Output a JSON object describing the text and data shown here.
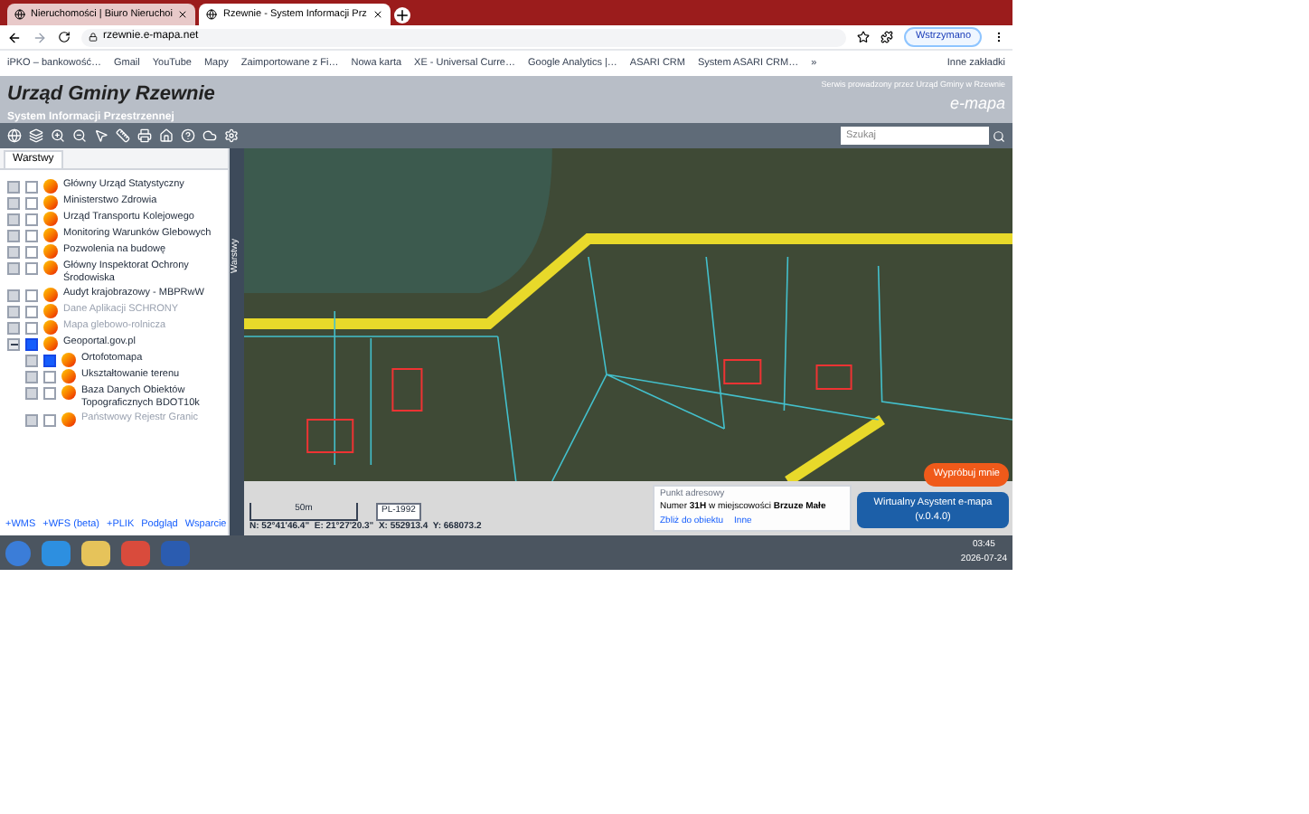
{
  "browser": {
    "tabs": [
      {
        "label": "Nieruchomości | Biuro Nieruchoi",
        "selected": false
      },
      {
        "label": "Rzewnie - System Informacji Prz",
        "selected": true
      }
    ],
    "address": "rzewnie.e-mapa.net",
    "profile": "Wstrzymano",
    "bookmarks": [
      "iPKO – bankowość…",
      "Gmail",
      "YouTube",
      "Mapy",
      "Zaimportowane z Fi…",
      "Nowa karta",
      "XE - Universal Curre…",
      "Google Analytics |…",
      "ASARI CRM",
      "System ASARI CRM…"
    ],
    "more_bookmarks": "»",
    "other_bookmarks": "Inne zakładki"
  },
  "header": {
    "title": "Urząd Gminy Rzewnie",
    "subtitle": "System Informacji Przestrzennej",
    "note": "Serwis prowadzony przez Urząd Gminy w Rzewnie",
    "logo": "e-mapa"
  },
  "search": {
    "placeholder": "Szukaj"
  },
  "panel": {
    "tab": "Warstwy",
    "layers": [
      {
        "name": "Główny Urząd Statystyczny",
        "checked": false,
        "disabled": false,
        "expanded": false
      },
      {
        "name": "Ministerstwo Zdrowia",
        "checked": false,
        "disabled": false,
        "expanded": false
      },
      {
        "name": "Urząd Transportu Kolejowego",
        "checked": false,
        "disabled": false,
        "expanded": false
      },
      {
        "name": "Monitoring Warunków Glebowych",
        "checked": false,
        "disabled": false,
        "expanded": false
      },
      {
        "name": "Pozwolenia na budowę",
        "checked": false,
        "disabled": false,
        "expanded": false
      },
      {
        "name": "Główny Inspektorat Ochrony Środowiska",
        "checked": false,
        "disabled": false,
        "expanded": false
      },
      {
        "name": "Audyt krajobrazowy - MBPRwW",
        "checked": false,
        "disabled": false,
        "expanded": false
      },
      {
        "name": "Dane Aplikacji SCHRONY",
        "checked": false,
        "disabled": true,
        "expanded": false
      },
      {
        "name": "Mapa glebowo-rolnicza",
        "checked": false,
        "disabled": true,
        "expanded": false
      },
      {
        "name": "Geoportal.gov.pl",
        "checked": true,
        "disabled": false,
        "expanded": true,
        "children": [
          {
            "name": "Ortofotomapa",
            "checked": true,
            "disabled": false,
            "expanded": false
          },
          {
            "name": "Ukształtowanie terenu",
            "checked": false,
            "disabled": false,
            "expanded": false
          },
          {
            "name": "Baza Danych Obiektów Topograficznych BDOT10k",
            "checked": false,
            "disabled": false,
            "expanded": false
          },
          {
            "name": "Państwowy Rejestr Granic",
            "checked": false,
            "disabled": true,
            "expanded": false
          }
        ]
      }
    ],
    "links": [
      "+WMS",
      "+WFS (beta)",
      "+PLIK",
      "Podgląd",
      "Wsparcie"
    ]
  },
  "map": {
    "side_tab": "Warstwy",
    "scale": "50m",
    "crs": "PL-1992",
    "coords": "N: 52°41'46.4\"  E: 21°27'20.3\"  X: 552913.4  Y: 668073.2",
    "popup": {
      "title": "Punkt adresowy",
      "text": "Numer **31H** w miejscowości **Brzuze Małe**",
      "links": [
        "Zbliż do obiektu",
        "Inne"
      ]
    },
    "try_button": "Wypróbuj mnie",
    "assistant": "Wirtualny Asystent e-mapa (v.0.4.0)"
  },
  "taskbar": {
    "time": "03:45",
    "date": "2026-07-24"
  }
}
